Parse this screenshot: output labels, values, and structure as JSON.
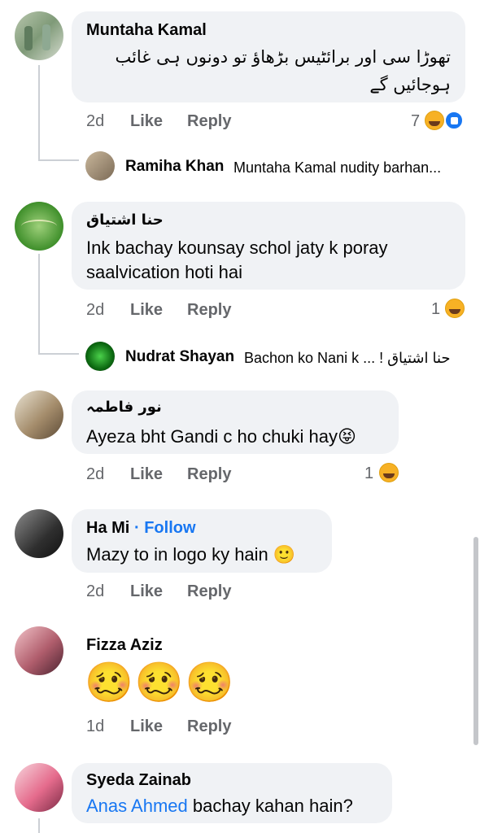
{
  "comments": [
    {
      "name": "Muntaha Kamal",
      "text_line1": "تھوڑا سی اور برائٹیس بڑھاؤ تو دونوں ہی غائب",
      "text_line2": "ہوجائیں گے",
      "time": "2d",
      "like": "Like",
      "reply": "Reply",
      "reactions": "7"
    },
    {
      "reply_name": "Ramiha Khan",
      "reply_text": "Muntaha Kamal nudity barhan..."
    },
    {
      "name": "حنا اشتیاق",
      "text_line1": "Ink bachay kounsay schol jaty k poray",
      "text_line2": "saalvication hoti hai",
      "time": "2d",
      "like": "Like",
      "reply": "Reply",
      "reactions": "1"
    },
    {
      "reply_name": "Nudrat Shayan",
      "reply_text": "Bachon ko Nani k ... ! حنا اشتیاق"
    },
    {
      "name": "نور فاطمہ",
      "text_line1": "Ayeza bht Gandi c ho chuki hay😝",
      "time": "2d",
      "like": "Like",
      "reply": "Reply",
      "reactions": "1"
    },
    {
      "name": "Ha Mi",
      "follow": "· Follow",
      "text_line1": "Mazy to in logo ky hain 🙂",
      "time": "2d",
      "like": "Like",
      "reply": "Reply"
    },
    {
      "name": "Fizza Aziz",
      "emojis": "🥴🥴🥴",
      "time": "1d",
      "like": "Like",
      "reply": "Reply"
    },
    {
      "name": "Syeda Zainab",
      "mention": "Anas Ahmed",
      "text_line1": " bachay kahan hain?"
    }
  ],
  "colors": {
    "bubble": "#f0f2f5",
    "meta": "#65676b",
    "link": "#1877f2",
    "haha": "#f7b125",
    "like_blue": "#1877f2"
  },
  "icons": [
    "haha-reaction-icon",
    "like-reaction-icon"
  ]
}
